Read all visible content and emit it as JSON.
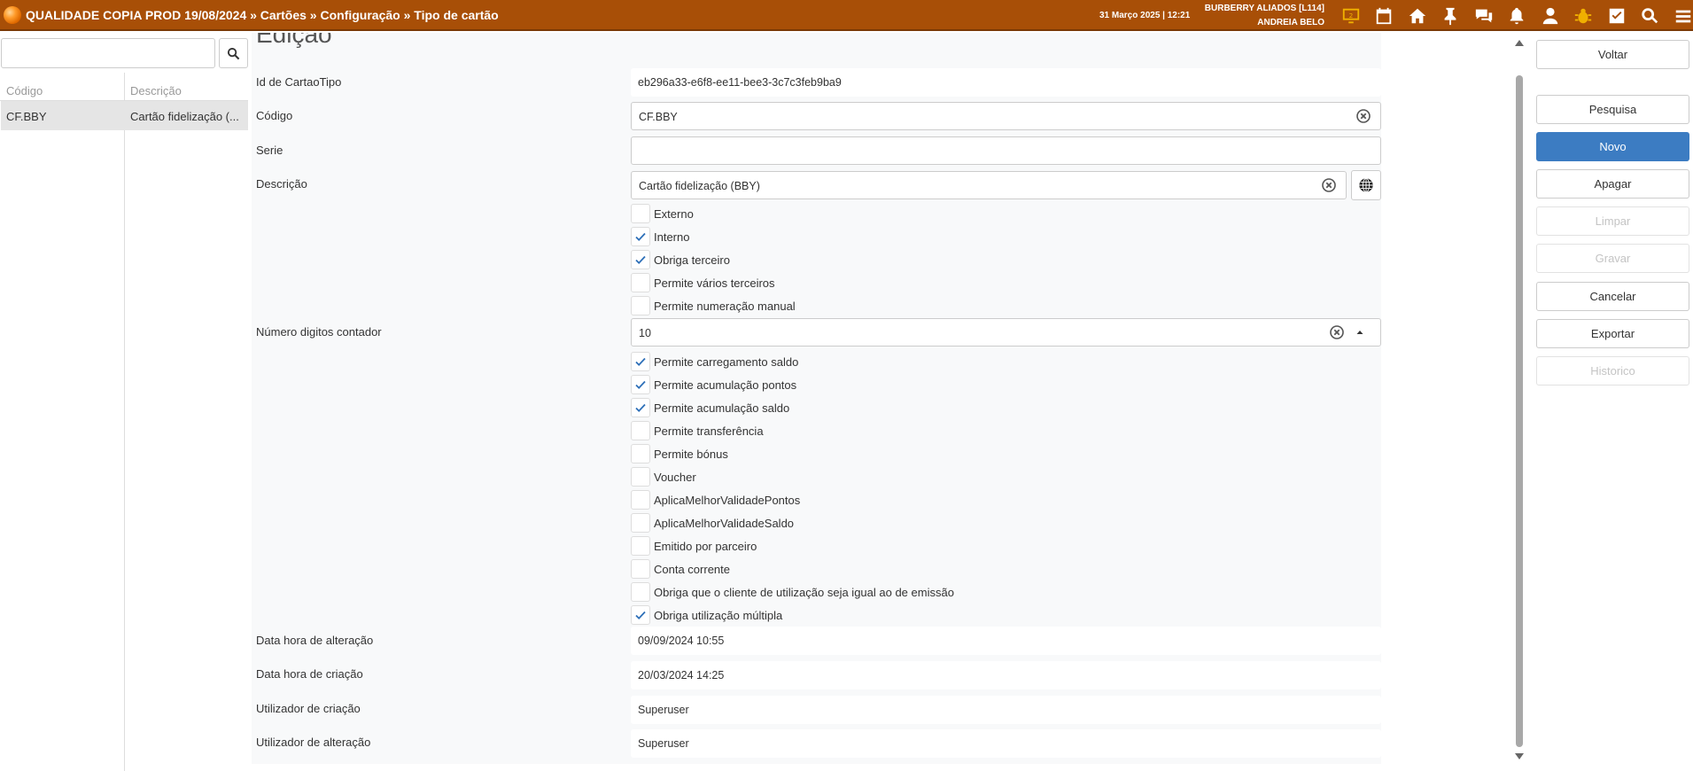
{
  "header": {
    "breadcrumb": "QUALIDADE COPIA PROD 19/08/2024 » Cartões » Configuração » Tipo de cartão",
    "datetime": "31 Março 2025 | 12:21",
    "company": "BURBERRY ALIADOS [L114]",
    "username": "ANDREIA BELO",
    "icons": [
      "monitor-icon",
      "calendar-icon",
      "home-icon",
      "pin-icon",
      "chat-icon",
      "bell-icon",
      "user-icon",
      "bug-icon",
      "checkbox-icon",
      "search-icon",
      "menu-icon"
    ],
    "colors": {
      "bar": "#a84f07",
      "accent_icon": "#f0b000"
    }
  },
  "left": {
    "search_value": "",
    "columns": {
      "code": "Código",
      "description": "Descrição"
    },
    "rows": [
      {
        "code": "CF.BBY",
        "description": "Cartão fidelização (..."
      }
    ]
  },
  "form": {
    "title": "Edição",
    "id_label": "Id de CartaoTipo",
    "id_value": "eb296a33-e6f8-ee11-bee3-3c7c3feb9ba9",
    "codigo_label": "Código",
    "codigo_value": "CF.BBY",
    "serie_label": "Serie",
    "serie_value": "",
    "descricao_label": "Descrição",
    "descricao_value": "Cartão fidelização (BBY)",
    "checks_a": [
      {
        "label": "Externo",
        "checked": false
      },
      {
        "label": "Interno",
        "checked": true
      },
      {
        "label": "Obriga terceiro",
        "checked": true
      },
      {
        "label": "Permite vários terceiros",
        "checked": false
      },
      {
        "label": "Permite numeração manual",
        "checked": false
      }
    ],
    "digitos_label": "Número digitos contador",
    "digitos_value": "10",
    "checks_b": [
      {
        "label": "Permite carregamento saldo",
        "checked": true
      },
      {
        "label": "Permite acumulação pontos",
        "checked": true
      },
      {
        "label": "Permite acumulação saldo",
        "checked": true
      },
      {
        "label": "Permite transferência",
        "checked": false
      },
      {
        "label": "Permite bónus",
        "checked": false
      },
      {
        "label": "Voucher",
        "checked": false
      },
      {
        "label": "AplicaMelhorValidadePontos",
        "checked": false
      },
      {
        "label": "AplicaMelhorValidadeSaldo",
        "checked": false
      },
      {
        "label": "Emitido por parceiro",
        "checked": false
      },
      {
        "label": "Conta corrente",
        "checked": false
      },
      {
        "label": "Obriga que o cliente de utilização seja igual ao de emissão",
        "checked": false
      },
      {
        "label": "Obriga utilização múltipla",
        "checked": true
      }
    ],
    "alteracao_label": "Data hora de alteração",
    "alteracao_value": "09/09/2024 10:55",
    "criacao_label": "Data hora de criação",
    "criacao_value": "20/03/2024 14:25",
    "util_criacao_label": "Utilizador de criação",
    "util_criacao_value": "Superuser",
    "util_alteracao_label": "Utilizador de alteração",
    "util_alteracao_value": "Superuser"
  },
  "actions": {
    "voltar": "Voltar",
    "pesquisa": "Pesquisa",
    "novo": "Novo",
    "apagar": "Apagar",
    "limpar": "Limpar",
    "gravar": "Gravar",
    "cancelar": "Cancelar",
    "exportar": "Exportar",
    "historico": "Historico"
  }
}
